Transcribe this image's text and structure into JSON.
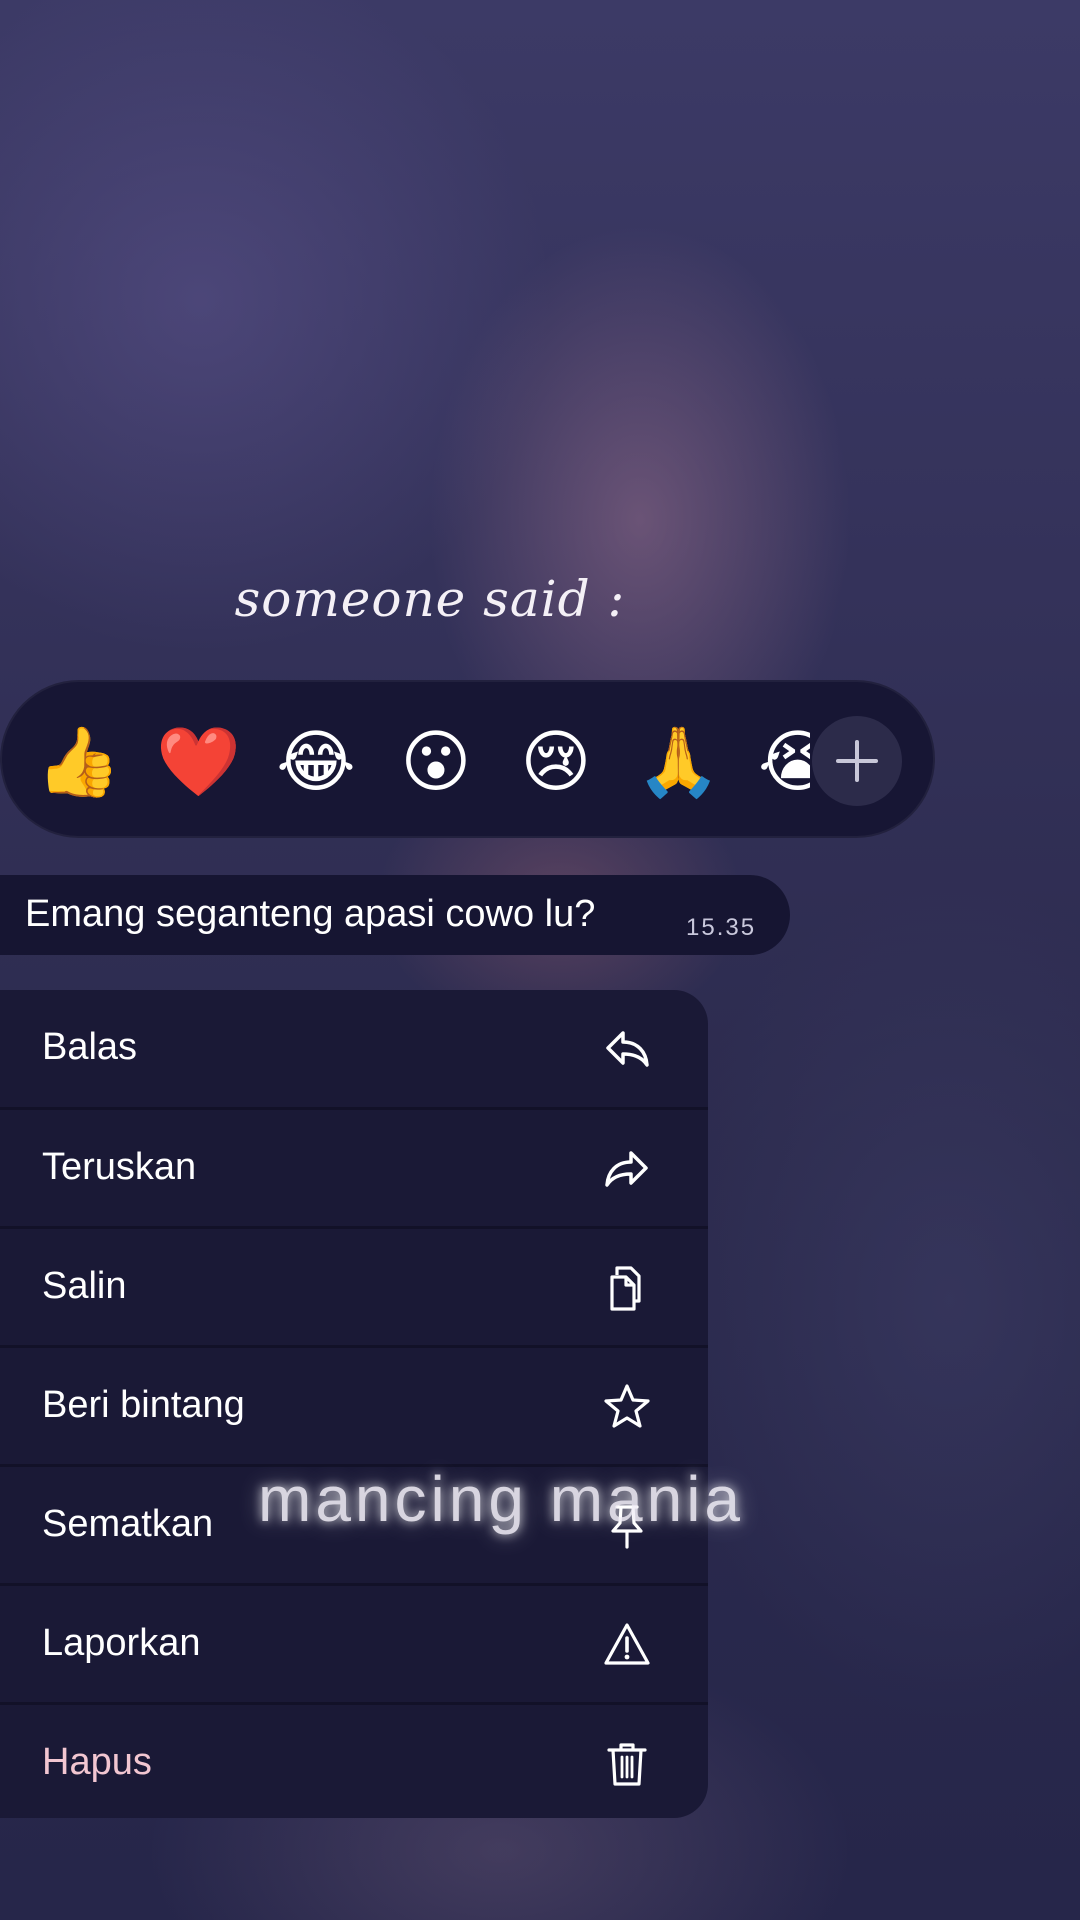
{
  "caption": "someone said :",
  "reactions": {
    "emojis": [
      {
        "name": "thumbs-up-emoji",
        "char": "👍"
      },
      {
        "name": "heart-emoji",
        "char": "❤️"
      },
      {
        "name": "tears-of-joy-emoji",
        "char": "😂"
      },
      {
        "name": "surprised-emoji",
        "char": "😮"
      },
      {
        "name": "sad-tear-emoji",
        "char": "😢"
      },
      {
        "name": "folded-hands-emoji",
        "char": "🙏"
      },
      {
        "name": "loudly-crying-emoji",
        "char": "😭"
      }
    ],
    "add_icon": "plus-icon"
  },
  "message": {
    "text": "Emang seganteng apasi cowo lu?",
    "time": "15.35"
  },
  "menu": {
    "items": [
      {
        "label": "Balas",
        "icon": "reply-icon"
      },
      {
        "label": "Teruskan",
        "icon": "forward-icon"
      },
      {
        "label": "Salin",
        "icon": "copy-icon"
      },
      {
        "label": "Beri bintang",
        "icon": "star-icon"
      },
      {
        "label": "Sematkan",
        "icon": "pin-icon"
      },
      {
        "label": "Laporkan",
        "icon": "warning-icon"
      },
      {
        "label": "Hapus",
        "icon": "trash-icon"
      }
    ]
  },
  "watermark": "mancing mania",
  "colors": {
    "danger": "#f2c6d1",
    "panel": "#1a1936"
  }
}
